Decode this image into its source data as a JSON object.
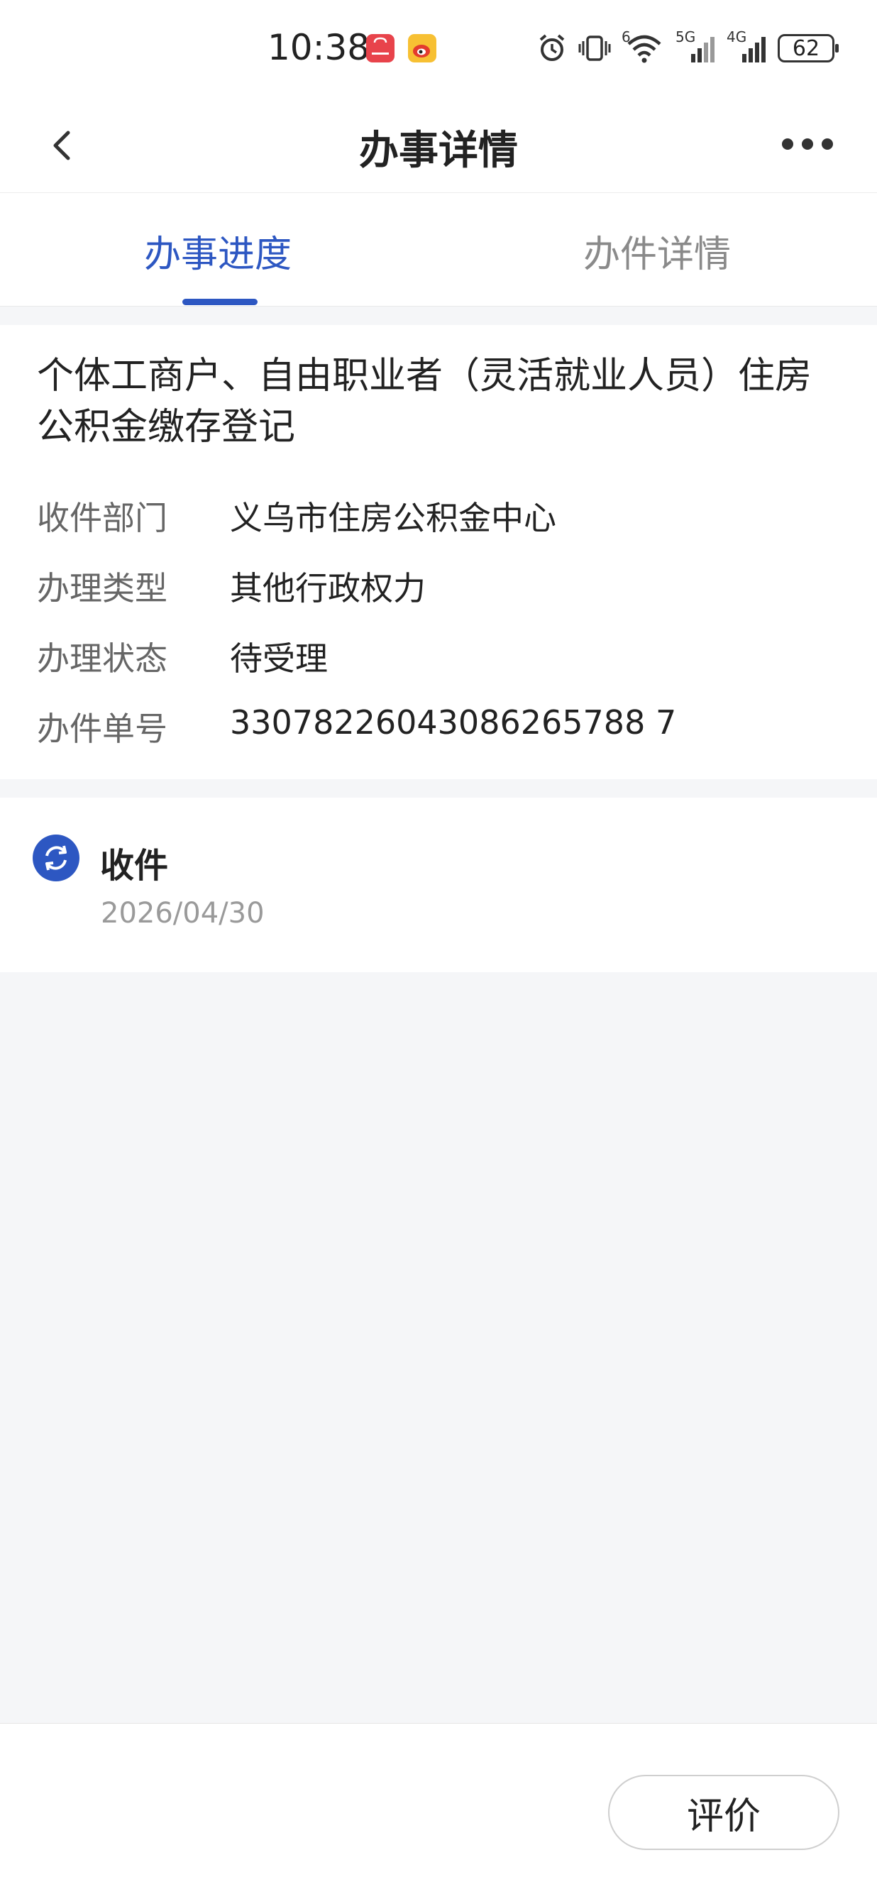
{
  "status_bar": {
    "time": "10:38",
    "battery": "62",
    "network_labels": [
      "6",
      "5G",
      "4G"
    ],
    "icons": [
      "huawei-app-icon",
      "weibo-icon",
      "alarm-icon",
      "vibrate-icon",
      "wifi-icon",
      "signal-icon",
      "signal-icon",
      "battery-icon"
    ]
  },
  "nav": {
    "title": "办事详情",
    "back_icon": "chevron-left-icon",
    "more_icon": "more-icon"
  },
  "tabs": [
    {
      "label": "办事进度",
      "active": true
    },
    {
      "label": "办件详情",
      "active": false
    }
  ],
  "item": {
    "title": "个体工商户、自由职业者（灵活就业人员）住房公积金缴存登记",
    "fields": [
      {
        "label": "收件部门",
        "value": "义乌市住房公积金中心"
      },
      {
        "label": "办理类型",
        "value": "其他行政权力"
      },
      {
        "label": "办理状态",
        "value": "待受理"
      },
      {
        "label": "办件单号",
        "value": "33078226043086265788 7"
      }
    ]
  },
  "progress": {
    "step_label": "收件",
    "step_date": "2026/04/30",
    "step_icon": "refresh-icon"
  },
  "bottom": {
    "rate_label": "评价"
  },
  "colors": {
    "accent": "#2d57c2",
    "background": "#f5f6f8"
  }
}
